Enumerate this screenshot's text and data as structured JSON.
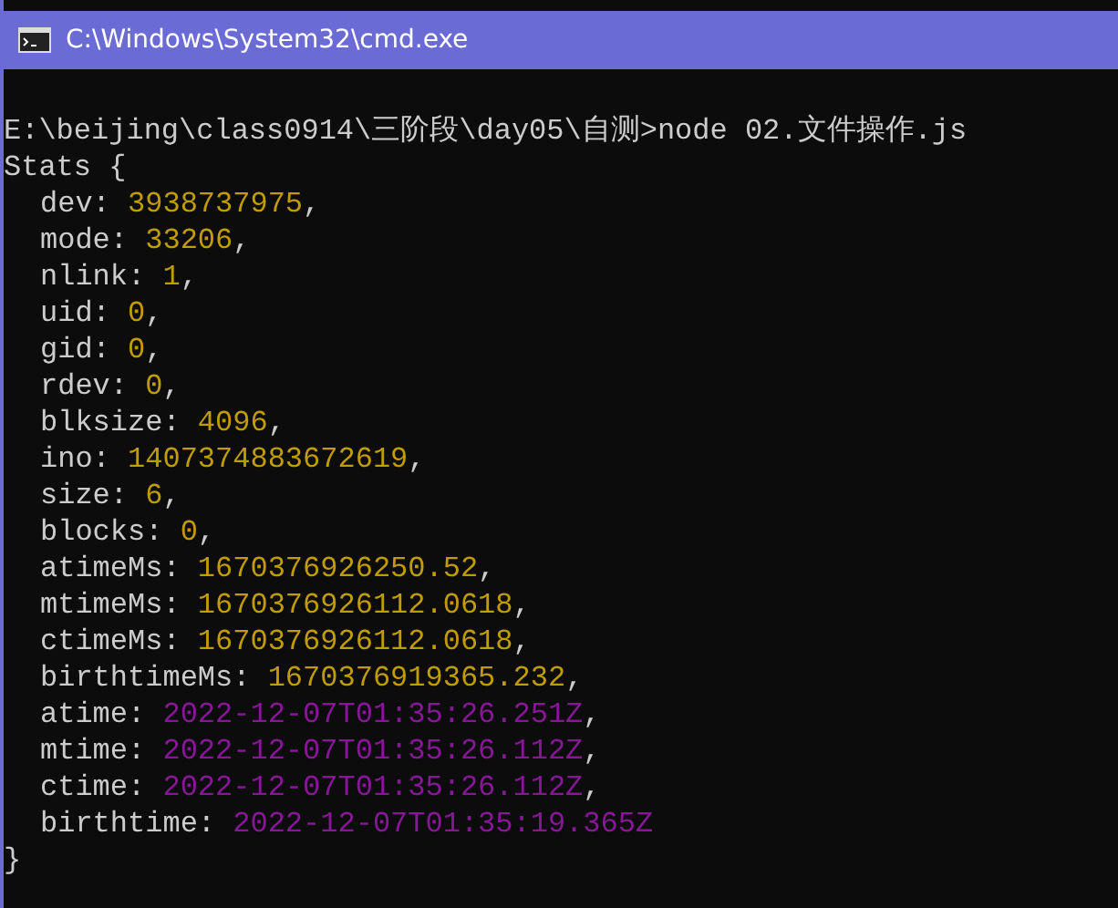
{
  "window": {
    "title": "C:\\Windows\\System32\\cmd.exe"
  },
  "console": {
    "command_line": "E:\\beijing\\class0914\\三阶段\\day05\\自测>node 02.文件操作.js",
    "object_open": "Stats {",
    "object_close": "}",
    "fields": [
      {
        "key": "dev:",
        "value": "3938737975",
        "kind": "number",
        "suffix": ","
      },
      {
        "key": "mode:",
        "value": "33206",
        "kind": "number",
        "suffix": ","
      },
      {
        "key": "nlink:",
        "value": "1",
        "kind": "number",
        "suffix": ","
      },
      {
        "key": "uid:",
        "value": "0",
        "kind": "number",
        "suffix": ","
      },
      {
        "key": "gid:",
        "value": "0",
        "kind": "number",
        "suffix": ","
      },
      {
        "key": "rdev:",
        "value": "0",
        "kind": "number",
        "suffix": ","
      },
      {
        "key": "blksize:",
        "value": "4096",
        "kind": "number",
        "suffix": ","
      },
      {
        "key": "ino:",
        "value": "1407374883672619",
        "kind": "number",
        "suffix": ","
      },
      {
        "key": "size:",
        "value": "6",
        "kind": "number",
        "suffix": ","
      },
      {
        "key": "blocks:",
        "value": "0",
        "kind": "number",
        "suffix": ","
      },
      {
        "key": "atimeMs:",
        "value": "1670376926250.52",
        "kind": "number",
        "suffix": ","
      },
      {
        "key": "mtimeMs:",
        "value": "1670376926112.0618",
        "kind": "number",
        "suffix": ","
      },
      {
        "key": "ctimeMs:",
        "value": "1670376926112.0618",
        "kind": "number",
        "suffix": ","
      },
      {
        "key": "birthtimeMs:",
        "value": "1670376919365.232",
        "kind": "number",
        "suffix": ","
      },
      {
        "key": "atime:",
        "value": "2022-12-07T01:35:26.251Z",
        "kind": "date",
        "suffix": ","
      },
      {
        "key": "mtime:",
        "value": "2022-12-07T01:35:26.112Z",
        "kind": "date",
        "suffix": ","
      },
      {
        "key": "ctime:",
        "value": "2022-12-07T01:35:26.112Z",
        "kind": "date",
        "suffix": ","
      },
      {
        "key": "birthtime:",
        "value": "2022-12-07T01:35:19.365Z",
        "kind": "date"
      }
    ]
  }
}
